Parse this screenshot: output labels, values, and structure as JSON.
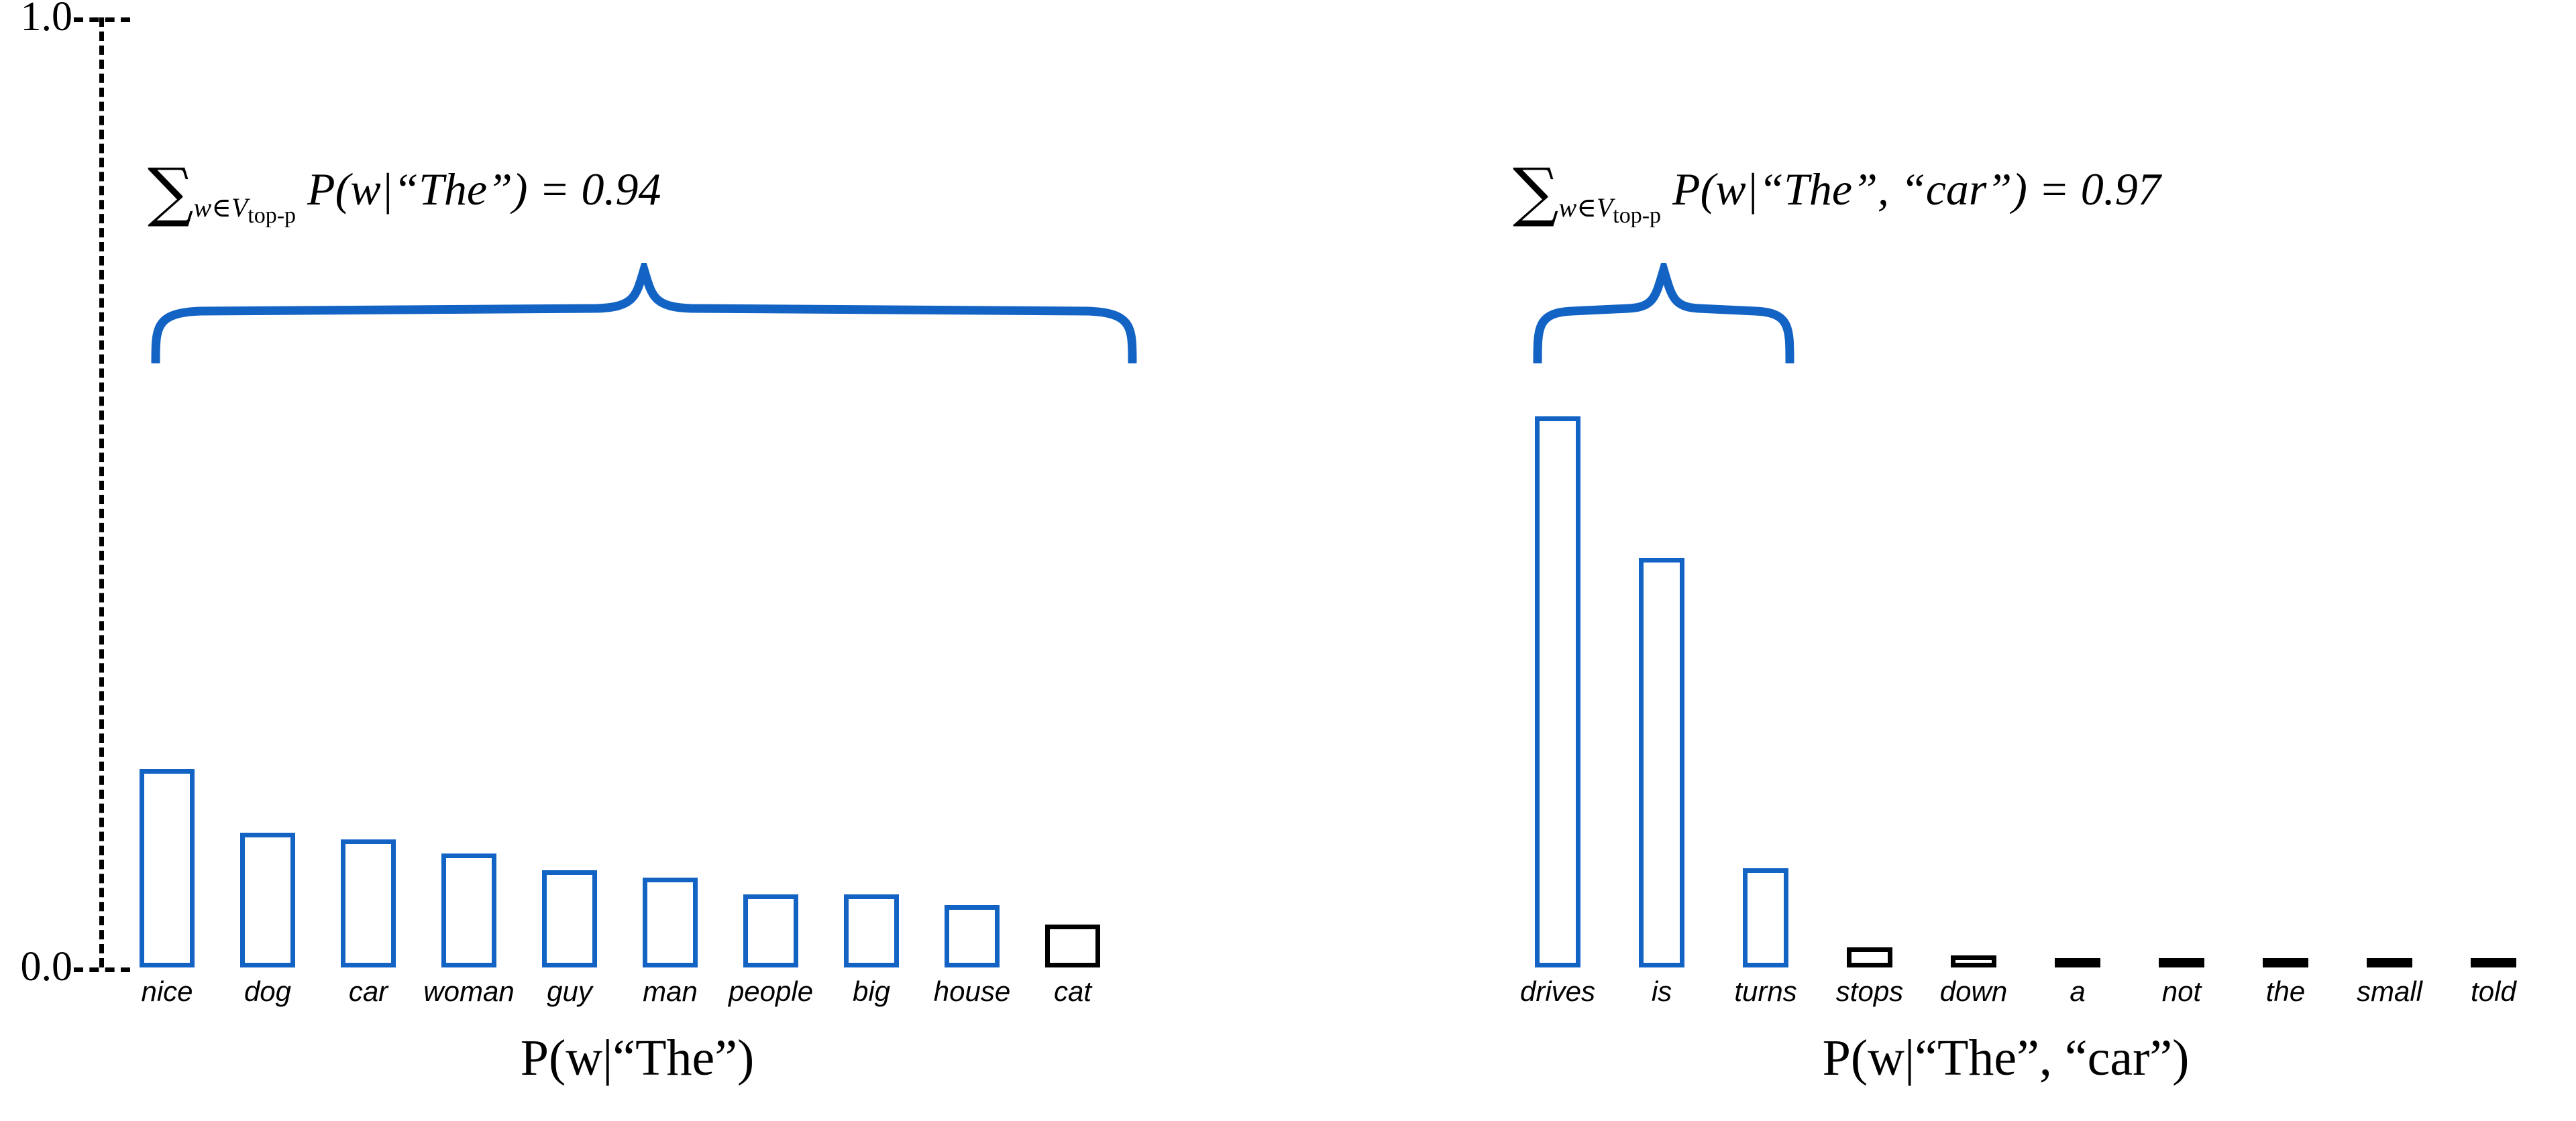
{
  "axis": {
    "y_ticks": [
      "1.0",
      "0.0"
    ],
    "y_top_label": "1.0",
    "y_bottom_label": "0.0"
  },
  "left_panel": {
    "formula": {
      "sum_symbol": "∑",
      "subscript_main": "w∈V",
      "subscript_sub": "top-p",
      "body": "P(w|“The”) = 0.94",
      "full_text": "∑ w∈V top-p P(w|“The”) = 0.94",
      "mass_value": "0.94"
    },
    "axis_title": "P(w|“The”)",
    "brace_color": "#1263C4"
  },
  "right_panel": {
    "formula": {
      "sum_symbol": "∑",
      "subscript_main": "w∈V",
      "subscript_sub": "top-p",
      "body": "P(w|“The”, “car”) = 0.97",
      "full_text": "∑ w∈V top-p P(w|“The”, “car”) = 0.97",
      "mass_value": "0.97"
    },
    "axis_title": "P(w|“The”, “car”)",
    "brace_color": "#1263C4"
  },
  "colors": {
    "in_top_p": "#1263C4",
    "out_top_p": "#000000",
    "axis": "#000000",
    "background": "#FFFFFF"
  },
  "chart_data": [
    {
      "type": "bar",
      "title": "P(w|“The”)",
      "xlabel": "P(w|“The”)",
      "ylabel": "",
      "ylim": [
        0.0,
        1.0
      ],
      "grid": false,
      "legend": "none",
      "annotation": "∑_{w∈V_top-p} P(w|“The”) = 0.94",
      "top_p_mass": 0.94,
      "categories": [
        "nice",
        "dog",
        "car",
        "woman",
        "guy",
        "man",
        "people",
        "big",
        "house",
        "cat"
      ],
      "values": [
        0.21,
        0.14,
        0.135,
        0.12,
        0.1,
        0.095,
        0.077,
        0.077,
        0.066,
        0.045
      ],
      "in_top_p": [
        true,
        true,
        true,
        true,
        true,
        true,
        true,
        true,
        true,
        false
      ]
    },
    {
      "type": "bar",
      "title": "P(w|“The”, “car”)",
      "xlabel": "P(w|“The”, “car”)",
      "ylabel": "",
      "ylim": [
        0.0,
        1.0
      ],
      "grid": false,
      "legend": "none",
      "annotation": "∑_{w∈V_top-p} P(w|“The”, “car”) = 0.97",
      "top_p_mass": 0.97,
      "categories": [
        "drives",
        "is",
        "turns",
        "stops",
        "down",
        "a",
        "not",
        "the",
        "small",
        "told"
      ],
      "values": [
        0.58,
        0.425,
        0.105,
        0.02,
        0.012,
        0.004,
        0.004,
        0.004,
        0.004,
        0.004
      ],
      "in_top_p": [
        true,
        true,
        true,
        false,
        false,
        false,
        false,
        false,
        false,
        false
      ]
    }
  ]
}
